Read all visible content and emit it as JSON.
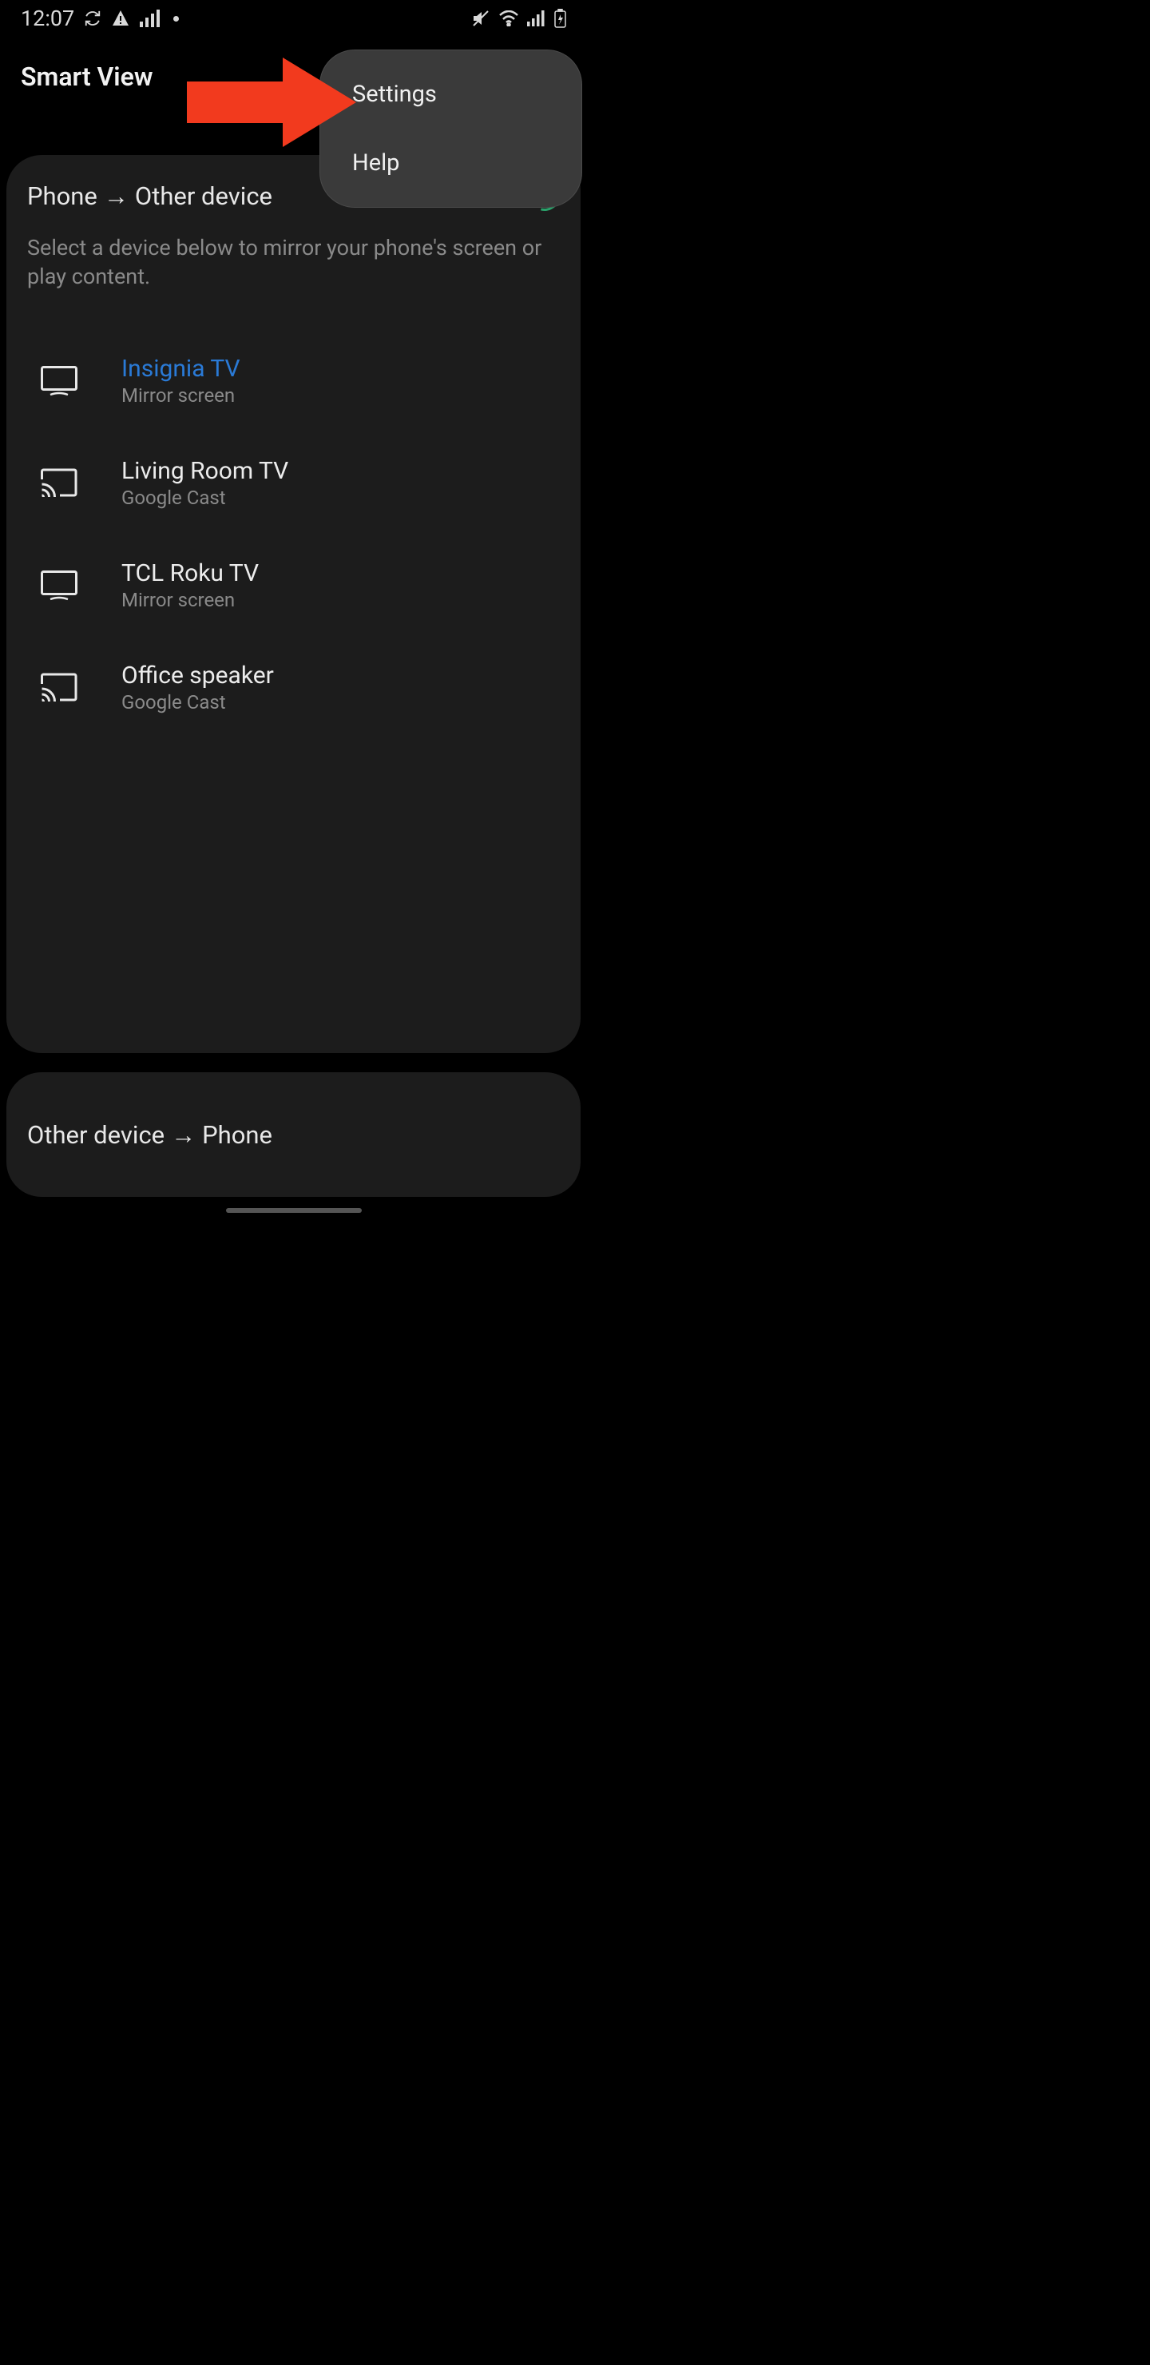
{
  "status": {
    "time": "12:07"
  },
  "header": {
    "title": "Smart View"
  },
  "popup": {
    "settings": "Settings",
    "help": "Help"
  },
  "main": {
    "direction_from": "Phone",
    "arrow": "→",
    "direction_to": "Other device",
    "description": "Select a device below to mirror your phone's screen or play content.",
    "devices": [
      {
        "name": "Insignia TV",
        "sub": "Mirror screen",
        "icon": "tv",
        "highlight": true
      },
      {
        "name": "Living Room TV",
        "sub": "Google Cast",
        "icon": "cast",
        "highlight": false
      },
      {
        "name": "TCL Roku TV",
        "sub": "Mirror screen",
        "icon": "tv",
        "highlight": false
      },
      {
        "name": "Office speaker",
        "sub": "Google Cast",
        "icon": "cast",
        "highlight": false
      }
    ]
  },
  "bottom": {
    "direction_from": "Other device",
    "arrow": "→",
    "direction_to": "Phone"
  },
  "colors": {
    "accent_blue": "#2a7ad6",
    "arrow_red": "#f23a1e"
  }
}
